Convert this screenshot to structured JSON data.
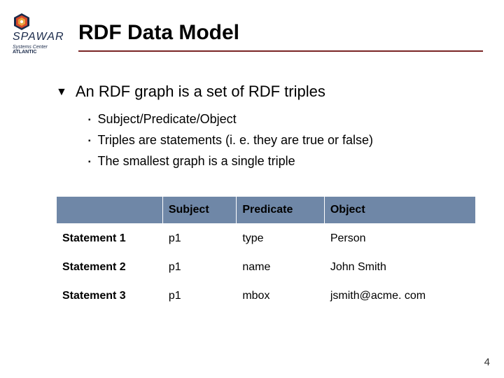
{
  "logo": {
    "main": "SPAWAR",
    "sub1": "Systems Center",
    "sub2": "ATLANTIC"
  },
  "title": "RDF Data Model",
  "main_bullet": "An RDF graph is a set of RDF triples",
  "sub_bullets": [
    "Subject/Predicate/Object",
    "Triples are statements (i. e. they are true or false)",
    "The smallest graph is a single triple"
  ],
  "table": {
    "headers": [
      "",
      "Subject",
      "Predicate",
      "Object"
    ],
    "rows": [
      {
        "label": "Statement 1",
        "cells": [
          "p1",
          "type",
          "Person"
        ]
      },
      {
        "label": "Statement 2",
        "cells": [
          "p1",
          "name",
          "John Smith"
        ]
      },
      {
        "label": "Statement 3",
        "cells": [
          "p1",
          "mbox",
          "jsmith@acme. com"
        ]
      }
    ]
  },
  "page_number": "4"
}
